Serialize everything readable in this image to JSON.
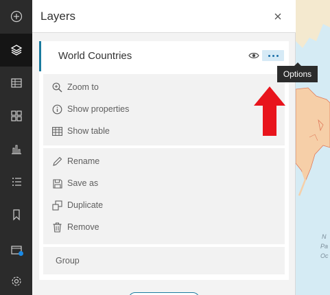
{
  "toolbar": {
    "items": [
      {
        "name": "add",
        "icon": "add-circle-icon"
      },
      {
        "name": "layers",
        "icon": "layers-icon",
        "active": true
      },
      {
        "name": "table",
        "icon": "table-icon"
      },
      {
        "name": "legend",
        "icon": "legend-icon"
      },
      {
        "name": "charts",
        "icon": "bar-chart-icon"
      },
      {
        "name": "list",
        "icon": "list-icon"
      },
      {
        "name": "bookmarks",
        "icon": "bookmark-icon"
      },
      {
        "name": "media",
        "icon": "media-icon",
        "badge": true
      },
      {
        "name": "settings",
        "icon": "gear-icon"
      }
    ]
  },
  "panel": {
    "title": "Layers",
    "close_icon": "close-icon"
  },
  "layer": {
    "name": "World Countries",
    "visibility_icon": "eye-icon",
    "options_icon": "ellipsis-icon"
  },
  "menu": {
    "group1": [
      {
        "label": "Zoom to",
        "icon": "zoom-in-icon"
      },
      {
        "label": "Show properties",
        "icon": "info-icon"
      },
      {
        "label": "Show table",
        "icon": "table-icon"
      }
    ],
    "group2": [
      {
        "label": "Rename",
        "icon": "pencil-icon"
      },
      {
        "label": "Save as",
        "icon": "save-icon"
      },
      {
        "label": "Duplicate",
        "icon": "duplicate-icon"
      },
      {
        "label": "Remove",
        "icon": "trash-icon"
      }
    ],
    "group3": [
      {
        "label": "Group"
      }
    ]
  },
  "tooltip": {
    "text": "Options"
  },
  "map": {
    "labels": [
      "N",
      "Pa",
      "Oc"
    ],
    "colors": {
      "water": "#d5ebf4",
      "land": "#f6cfa8",
      "border": "#e07a5a"
    }
  },
  "annotation": {
    "arrow_color": "#e8141c"
  }
}
